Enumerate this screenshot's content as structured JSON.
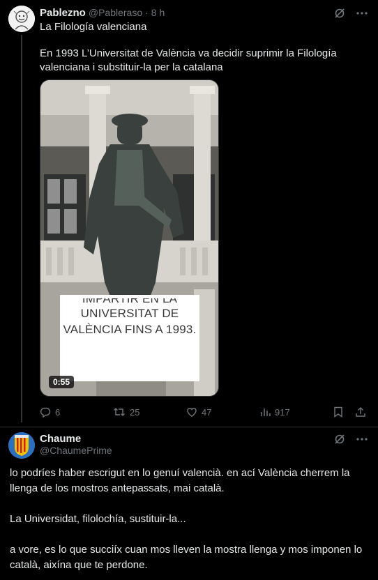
{
  "tweet": {
    "author_name": "Pablezno",
    "author_handle": "@Pableraso",
    "separator": "·",
    "time": "8 h",
    "title_line": "La Filología valenciana",
    "paragraph": "En 1993 L’Universitat de València va decidir suprimir la Filología valenciana i substituir-la per la catalana",
    "video": {
      "caption_lines": [
        "IMPARTIR EN LA",
        "UNIVERSITAT DE",
        "VALÈNCIA FINS A 1993."
      ],
      "duration": "0:55"
    },
    "actions": {
      "replies": "6",
      "retweets": "25",
      "likes": "47",
      "views": "917"
    }
  },
  "reply": {
    "author_name": "Chaume",
    "author_handle": "@ChaumePrime",
    "paragraphs": [
      "lo podríes haber escrigut en lo genuí valencià. en ací València cherrem la llenga de los mostros antepassats, mai català.",
      "La Universidat, filolochía, sustituir-la...",
      "a vore, es lo que succiíx cuan mos lleven la mostra llenga y mos imponen lo català, aixína que te perdone."
    ]
  },
  "colors": {
    "background": "#000000",
    "text_primary": "#e7e9ea",
    "text_secondary": "#71767b",
    "border": "#2f3336"
  },
  "icons": [
    "grok-icon",
    "more-icon",
    "reply-icon",
    "retweet-icon",
    "like-icon",
    "views-icon",
    "bookmark-icon",
    "share-icon"
  ]
}
